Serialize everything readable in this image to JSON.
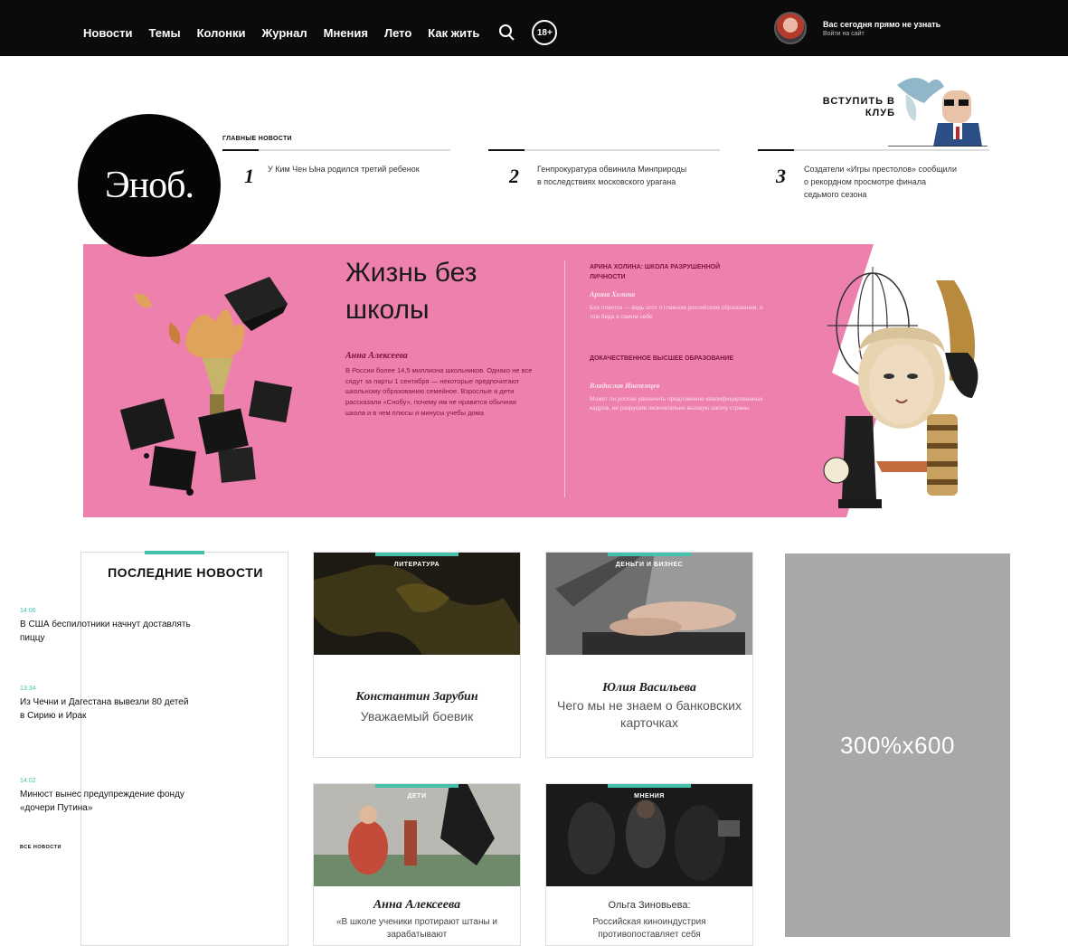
{
  "nav": {
    "items": [
      "Новости",
      "Темы",
      "Колонки",
      "Журнал",
      "Мнения",
      "Лето",
      "Как жить"
    ],
    "search_icon": "search-icon",
    "age_badge": "18+"
  },
  "user": {
    "name": "Вас сегодня прямо не узнать",
    "subtitle": "Войти на сайт"
  },
  "logo": {
    "text": "Эноб."
  },
  "main_news": {
    "title": "ГЛАВНЫЕ НОВОСТИ",
    "items": [
      {
        "num": "1",
        "text": "У Ким Чен Ына родился третий ребенок"
      },
      {
        "num": "2",
        "text": "Генпрокуратура обвинила Минприроды в последствиях московского урагана"
      },
      {
        "num": "3",
        "text": "Создатели «Игры престолов» сообщили о рекордном просмотре финала седьмого сезона"
      }
    ]
  },
  "join": {
    "label": "ВСТУПИТЬ В КЛУБ"
  },
  "banner": {
    "title": "Жизнь без школы",
    "author": "Анна Алексеева",
    "description": "В России более 14,5 миллиона школьников. Однако не все сядут за парты 1 сентября — некоторые предпочитают школьному образованию семейное. Взрослые и дети рассказали «Снобу», почему им не нравится обычная школа и в чем плюсы и минусы учебы дома",
    "side": [
      {
        "heading": "АРИНА ХОЛИНА: ШКОЛА РАЗРУШЕННОЙ ЛИЧНОСТИ",
        "author": "Арина Холина",
        "text": "Без отметок — ведь этот о главном российском образовании, о том беда в самом себе"
      },
      {
        "heading": "ДОКАЧЕСТВЕННОЕ ВЫСШЕЕ ОБРАЗОВАНИЕ",
        "author": "Владислав Иноземцев",
        "text": "Может ли россия увеличить предложение квалифицированных кадров, не разрушив окончательно высшую школу страны"
      }
    ]
  },
  "latest_news": {
    "title": "ПОСЛЕДНИЕ НОВОСТИ",
    "items": [
      {
        "time": "14:06",
        "text": "В США беспилотники начнут доставлять пиццу"
      },
      {
        "time": "13:34",
        "text": "Из Чечни и Дагестана вывезли 80 детей в Сирию и Ирак"
      },
      {
        "time": "14:02",
        "text": "Минюст вынес предупреждение фонду «дочери Путина»"
      }
    ],
    "all_label": "ВСЕ НОВОСТИ"
  },
  "cards": [
    {
      "tag": "ЛИТЕРАТУРА",
      "author": "Константин Зарубин",
      "title": "Уважаемый боевик"
    },
    {
      "tag": "ДЕНЬГИ И БИЗНЕС",
      "author": "Юлия Васильева",
      "title": "Чего мы не знаем о банковских карточках"
    },
    {
      "tag": "ДЕТИ",
      "author": "Анна Алексеева",
      "title": "«В школе ученики протирают штаны и зарабатывают"
    },
    {
      "tag": "МНЕНИЯ",
      "author": "Ольга Зиновьева:",
      "title": "Российская киноиндустрия противопоставляет себя"
    }
  ],
  "ad": {
    "text": "300%x600"
  },
  "colors": {
    "nav_bg": "#0b0b0b",
    "banner_pink": "#ee80ad",
    "accent_teal": "#45c0ad",
    "ad_gray": "#a7a8aa"
  }
}
